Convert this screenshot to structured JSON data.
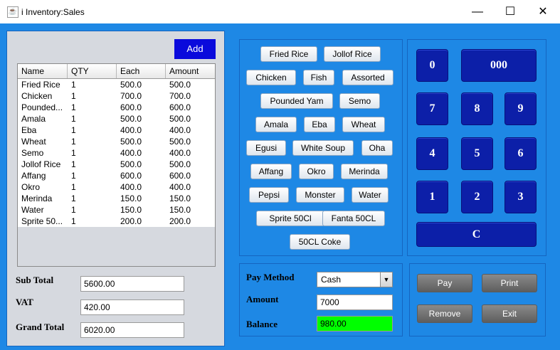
{
  "window": {
    "title": "i Inventory:Sales",
    "minimize": "—",
    "maximize": "☐",
    "close": "✕"
  },
  "order": {
    "add_label": "Add",
    "columns": [
      "Name",
      "QTY",
      "Each",
      "Amount"
    ],
    "rows": [
      [
        "Fried Rice",
        "1",
        "500.0",
        "500.0"
      ],
      [
        "Chicken",
        "1",
        "700.0",
        "700.0"
      ],
      [
        "Pounded...",
        "1",
        "600.0",
        "600.0"
      ],
      [
        "Amala",
        "1",
        "500.0",
        "500.0"
      ],
      [
        "Eba",
        "1",
        "400.0",
        "400.0"
      ],
      [
        "Wheat",
        "1",
        "500.0",
        "500.0"
      ],
      [
        "Semo",
        "1",
        "400.0",
        "400.0"
      ],
      [
        "Jollof Rice",
        "1",
        "500.0",
        "500.0"
      ],
      [
        "Affang",
        "1",
        "600.0",
        "600.0"
      ],
      [
        "Okro",
        "1",
        "400.0",
        "400.0"
      ],
      [
        "Merinda",
        "1",
        "150.0",
        "150.0"
      ],
      [
        "Water",
        "1",
        "150.0",
        "150.0"
      ],
      [
        "Sprite 50...",
        "1",
        "200.0",
        "200.0"
      ]
    ]
  },
  "totals": {
    "sub_total_label": "Sub Total",
    "sub_total_value": "5600.00",
    "vat_label": "VAT",
    "vat_value": "420.00",
    "grand_total_label": "Grand Total",
    "grand_total_value": "6020.00"
  },
  "food_items": [
    "Fried Rice",
    "Jollof Rice",
    "Chicken",
    "Fish",
    "Assorted",
    "Pounded Yam",
    "Semo",
    "Amala",
    "Eba",
    "Wheat",
    "Egusi",
    "White Soup",
    "Oha",
    "Affang",
    "Okro",
    "Merinda",
    "Pepsi",
    "Monster",
    "Water",
    "Sprite 50Cl",
    "Fanta 50CL",
    "50CL Coke"
  ],
  "keypad": [
    "0",
    "000",
    "7",
    "8",
    "9",
    "4",
    "5",
    "6",
    "1",
    "2",
    "3",
    "C"
  ],
  "payment": {
    "method_label": "Pay Method",
    "method_value": "Cash",
    "amount_label": "Amount",
    "amount_value": "7000",
    "balance_label": "Balance",
    "balance_value": "980.00",
    "balance_color": "#00ff00"
  },
  "actions": {
    "pay": "Pay",
    "print": "Print",
    "remove": "Remove",
    "exit": "Exit"
  },
  "colors": {
    "frame_blue": "#1e88e5",
    "add_button": "#0a0adc",
    "keypad_blue": "#0c1fa8",
    "action_gray": "#6e6e6e"
  },
  "icons": {
    "app": "java-cup-icon",
    "combo_arrow": "chevron-down-icon"
  }
}
